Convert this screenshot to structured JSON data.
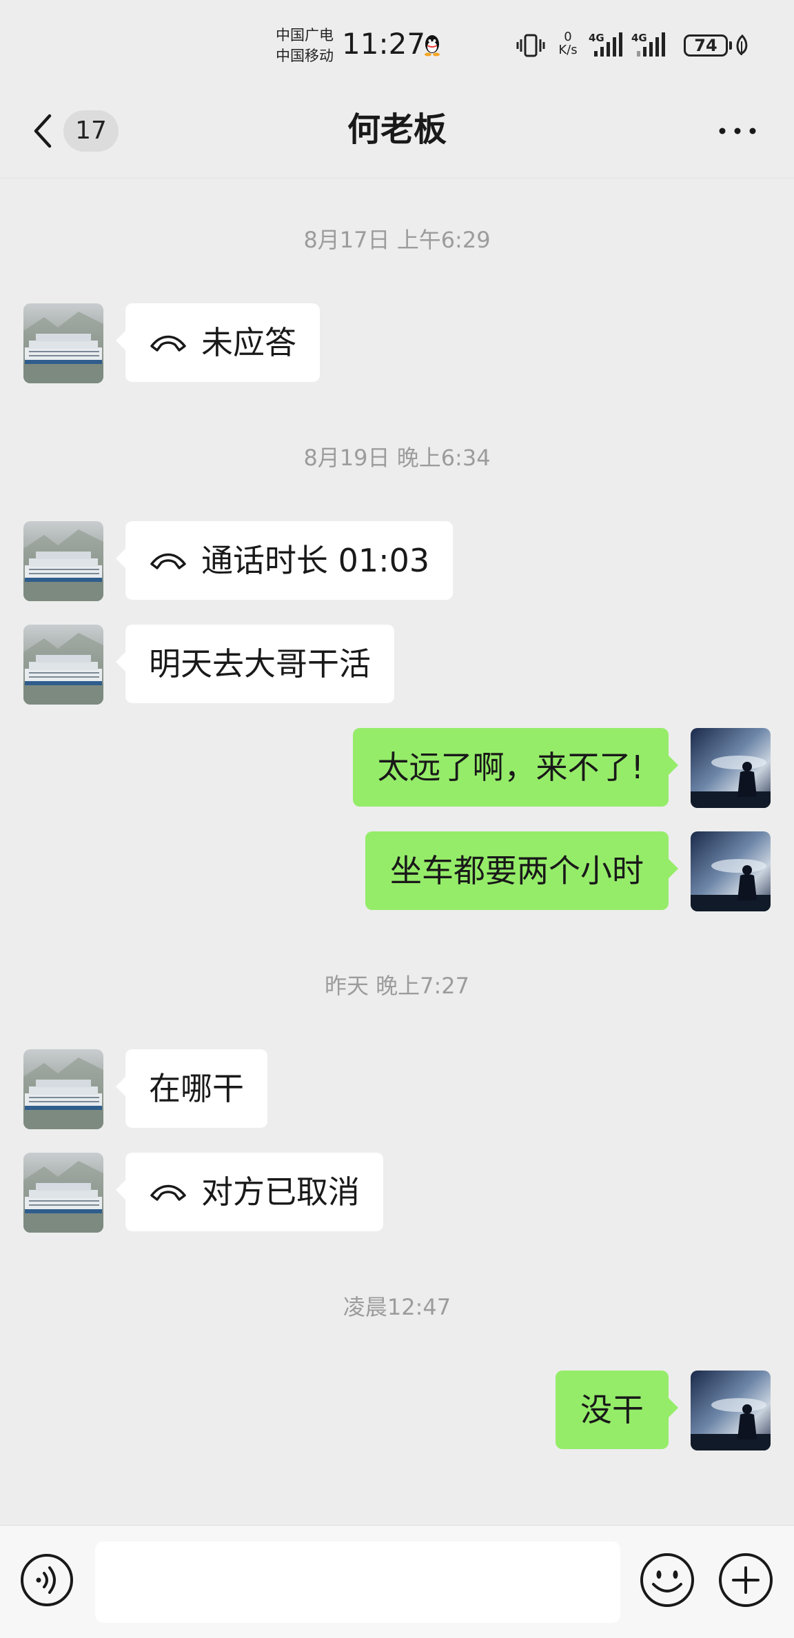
{
  "status_bar": {
    "carrier_1": "中国广电",
    "carrier_2": "中国移动",
    "time": "11:27",
    "net_speed_value": "0",
    "net_speed_unit": "K/s",
    "network_1": "4G",
    "network_2": "4G",
    "battery": "74"
  },
  "header": {
    "back_badge": "17",
    "title": "何老板"
  },
  "messages": [
    {
      "type": "timestamp",
      "text": "8月17日 上午6:29"
    },
    {
      "type": "call",
      "side": "left",
      "text": "未应答"
    },
    {
      "type": "timestamp",
      "text": "8月19日 晚上6:34"
    },
    {
      "type": "call",
      "side": "left",
      "text": "通话时长 01:03"
    },
    {
      "type": "text",
      "side": "left",
      "text": "明天去大哥干活"
    },
    {
      "type": "text",
      "side": "right",
      "text": "太远了啊，来不了!"
    },
    {
      "type": "text",
      "side": "right",
      "text": "坐车都要两个小时"
    },
    {
      "type": "timestamp",
      "text": "昨天 晚上7:27"
    },
    {
      "type": "text",
      "side": "left",
      "text": "在哪干"
    },
    {
      "type": "call",
      "side": "left",
      "text": "对方已取消"
    },
    {
      "type": "timestamp",
      "text": "凌晨12:47"
    },
    {
      "type": "text",
      "side": "right",
      "text": "没干"
    }
  ],
  "input": {
    "value": ""
  },
  "icons": {
    "back": "chevron-left-icon",
    "more": "more-icon",
    "voice": "voice-icon",
    "emoji": "emoji-icon",
    "plus": "plus-icon",
    "call": "phone-icon"
  },
  "colors": {
    "background": "#ededed",
    "incoming_bubble": "#ffffff",
    "outgoing_bubble": "#95ec69",
    "timestamp": "#9c9c9c",
    "input_bar": "#f7f7f7"
  }
}
